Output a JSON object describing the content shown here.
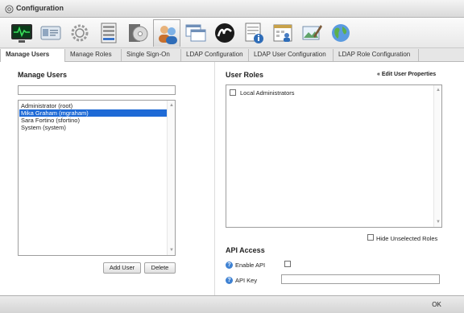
{
  "window": {
    "title": "Configuration",
    "icon": "gear-icon"
  },
  "toolbar": {
    "tools": [
      {
        "icon": "monitor-icon",
        "active": false
      },
      {
        "icon": "id-card-icon",
        "active": false
      },
      {
        "icon": "settings-gear-icon",
        "active": false
      },
      {
        "icon": "server-list-icon",
        "active": false
      },
      {
        "icon": "disc-install-icon",
        "active": false
      },
      {
        "icon": "users-icon",
        "active": true
      },
      {
        "icon": "windows-icon",
        "active": false
      },
      {
        "icon": "brand-logo-icon",
        "active": false
      },
      {
        "icon": "notepad-info-icon",
        "active": false
      },
      {
        "icon": "calendar-user-icon",
        "active": false
      },
      {
        "icon": "image-edit-icon",
        "active": false
      },
      {
        "icon": "globe-icon",
        "active": false
      }
    ]
  },
  "tabs": [
    {
      "label": "Manage Users",
      "active": true
    },
    {
      "label": "Manage Roles",
      "active": false
    },
    {
      "label": "Single Sign-On",
      "active": false
    },
    {
      "label": "LDAP Configuration",
      "active": false
    },
    {
      "label": "LDAP User Configuration",
      "active": false
    },
    {
      "label": "LDAP Role Configuration",
      "active": false
    }
  ],
  "manage_users": {
    "heading": "Manage Users",
    "search_value": "",
    "users": [
      {
        "label": "Administrator (root)",
        "selected": false
      },
      {
        "label": "Mika Graham (mgraham)",
        "selected": true
      },
      {
        "label": "Sara Fortino (sfortino)",
        "selected": false
      },
      {
        "label": "System (system)",
        "selected": false
      }
    ],
    "add_user_label": "Add User",
    "delete_label": "Delete"
  },
  "user_roles": {
    "heading": "User Roles",
    "edit_link": "« Edit User Properties",
    "roles": [
      {
        "label": "Local Administrators",
        "checked": false
      }
    ],
    "hide_unselected_label": "Hide Unselected Roles"
  },
  "api_access": {
    "heading": "API Access",
    "enable_api_label": "Enable API",
    "enable_api_checked": false,
    "api_key_label": "API Key",
    "api_key_value": ""
  },
  "footer": {
    "ok_label": "OK"
  },
  "colors": {
    "selection": "#1e6ad6",
    "help_icon": "#3f82d3"
  }
}
